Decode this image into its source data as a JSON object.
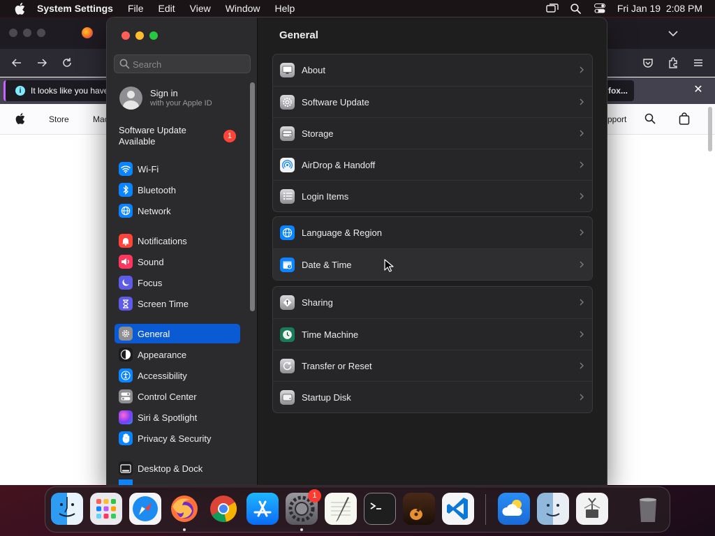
{
  "menubar": {
    "app_name": "System Settings",
    "menus": [
      "File",
      "Edit",
      "View",
      "Window",
      "Help"
    ],
    "clock": "Fri Jan 19  2:08 PM"
  },
  "browser": {
    "info_text": "It looks like you have",
    "fox_button": "fox...",
    "nav": {
      "store": "Store",
      "mac": "Mac",
      "support": "pport"
    }
  },
  "sidebar": {
    "search_placeholder": "Search",
    "signin_title": "Sign in",
    "signin_subtitle": "with your Apple ID",
    "update_label": "Software Update Available",
    "update_badge": "1",
    "items": [
      {
        "label": "Wi-Fi",
        "icon": "wifi-icon",
        "color": "#0a84ff"
      },
      {
        "label": "Bluetooth",
        "icon": "bluetooth-icon",
        "color": "#0a84ff"
      },
      {
        "label": "Network",
        "icon": "network-globe-icon",
        "color": "#0a84ff"
      },
      {
        "label": "Notifications",
        "icon": "bell-icon",
        "color": "#ff453a"
      },
      {
        "label": "Sound",
        "icon": "speaker-icon",
        "color": "#ff375f"
      },
      {
        "label": "Focus",
        "icon": "moon-icon",
        "color": "#5e5ce6"
      },
      {
        "label": "Screen Time",
        "icon": "hourglass-icon",
        "color": "#5e5ce6"
      },
      {
        "label": "General",
        "icon": "gear-icon",
        "color": "#8e8e93",
        "selected": true
      },
      {
        "label": "Appearance",
        "icon": "appearance-icon",
        "color": "#1c1c1e"
      },
      {
        "label": "Accessibility",
        "icon": "accessibility-icon",
        "color": "#0a84ff"
      },
      {
        "label": "Control Center",
        "icon": "control-center-icon",
        "color": "#8e8e93"
      },
      {
        "label": "Siri & Spotlight",
        "icon": "siri-icon",
        "color": "#bf5af2"
      },
      {
        "label": "Privacy & Security",
        "icon": "hand-icon",
        "color": "#0a84ff"
      },
      {
        "label": "Desktop & Dock",
        "icon": "dock-icon",
        "color": "#1c1c1e"
      }
    ]
  },
  "main": {
    "title": "General",
    "groups": [
      [
        {
          "label": "About",
          "icon": "monitor-icon"
        },
        {
          "label": "Software Update",
          "icon": "gear-update-icon"
        },
        {
          "label": "Storage",
          "icon": "storage-drive-icon"
        },
        {
          "label": "AirDrop & Handoff",
          "icon": "airdrop-icon"
        },
        {
          "label": "Login Items",
          "icon": "list-icon"
        }
      ],
      [
        {
          "label": "Language & Region",
          "icon": "globe-icon"
        },
        {
          "label": "Date & Time",
          "icon": "calendar-clock-icon"
        }
      ],
      [
        {
          "label": "Sharing",
          "icon": "sharing-icon"
        },
        {
          "label": "Time Machine",
          "icon": "time-machine-icon"
        },
        {
          "label": "Transfer or Reset",
          "icon": "reset-icon"
        },
        {
          "label": "Startup Disk",
          "icon": "disk-icon"
        }
      ]
    ]
  },
  "dock": {
    "apps": [
      "Finder",
      "Launchpad",
      "Safari",
      "Firefox",
      "Chrome",
      "App Store",
      "System Settings",
      "TextEdit",
      "Terminal",
      "GarageBand",
      "Visual Studio Code",
      "Weather",
      "Migration Assistant",
      "System Information",
      "Trash"
    ],
    "settings_badge": "1"
  }
}
